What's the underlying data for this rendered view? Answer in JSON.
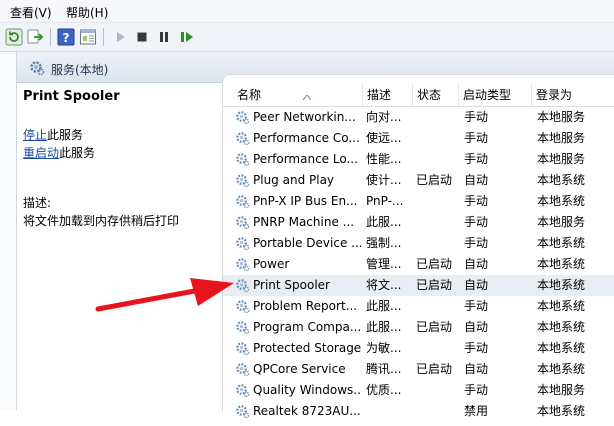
{
  "menu": {
    "items": [
      "查看(V)",
      "帮助(H)"
    ]
  },
  "toolbar": {
    "icons": [
      "refresh-icon",
      "export-icon",
      "help-icon",
      "properties-icon",
      "play-icon",
      "stop-icon",
      "pause-icon",
      "restart-icon"
    ]
  },
  "panel": {
    "title": "服务(本地)"
  },
  "detail": {
    "service_name": "Print Spooler",
    "stop_link": "停止",
    "stop_suffix": "此服务",
    "restart_link": "重启动",
    "restart_suffix": "此服务",
    "description_label": "描述:",
    "description_text": "将文件加载到内存供稍后打印"
  },
  "table": {
    "columns": [
      "名称",
      "描述",
      "状态",
      "启动类型",
      "登录为"
    ],
    "rows": [
      {
        "name": "Peer Networkin...",
        "desc": "向对...",
        "state": "",
        "startup": "手动",
        "logon": "本地服务"
      },
      {
        "name": "Performance Co...",
        "desc": "使远...",
        "state": "",
        "startup": "手动",
        "logon": "本地服务"
      },
      {
        "name": "Performance Lo...",
        "desc": "性能...",
        "state": "",
        "startup": "手动",
        "logon": "本地服务"
      },
      {
        "name": "Plug and Play",
        "desc": "使计...",
        "state": "已启动",
        "startup": "自动",
        "logon": "本地系统"
      },
      {
        "name": "PnP-X IP Bus En...",
        "desc": "PnP-...",
        "state": "",
        "startup": "手动",
        "logon": "本地系统"
      },
      {
        "name": "PNRP Machine ...",
        "desc": "此服...",
        "state": "",
        "startup": "手动",
        "logon": "本地服务"
      },
      {
        "name": "Portable Device ...",
        "desc": "强制...",
        "state": "",
        "startup": "手动",
        "logon": "本地系统"
      },
      {
        "name": "Power",
        "desc": "管理...",
        "state": "已启动",
        "startup": "自动",
        "logon": "本地系统"
      },
      {
        "name": "Print Spooler",
        "desc": "将文...",
        "state": "已启动",
        "startup": "自动",
        "logon": "本地系统"
      },
      {
        "name": "Problem Report...",
        "desc": "此服...",
        "state": "",
        "startup": "手动",
        "logon": "本地系统"
      },
      {
        "name": "Program Compa...",
        "desc": "此服...",
        "state": "已启动",
        "startup": "自动",
        "logon": "本地系统"
      },
      {
        "name": "Protected Storage",
        "desc": "为敏...",
        "state": "",
        "startup": "手动",
        "logon": "本地系统"
      },
      {
        "name": "QPCore Service",
        "desc": "腾讯...",
        "state": "已启动",
        "startup": "自动",
        "logon": "本地系统"
      },
      {
        "name": "Quality Windows...",
        "desc": "优质...",
        "state": "",
        "startup": "手动",
        "logon": "本地服务"
      },
      {
        "name": "Realtek 8723AU...",
        "desc": "",
        "state": "",
        "startup": "禁用",
        "logon": "本地系统"
      }
    ],
    "selected_row": 8
  },
  "colors": {
    "arrow": "#e8141c",
    "link": "#1a4aa8",
    "selected_row": "#e8edf3",
    "header_gradient": "#dce3ec"
  }
}
